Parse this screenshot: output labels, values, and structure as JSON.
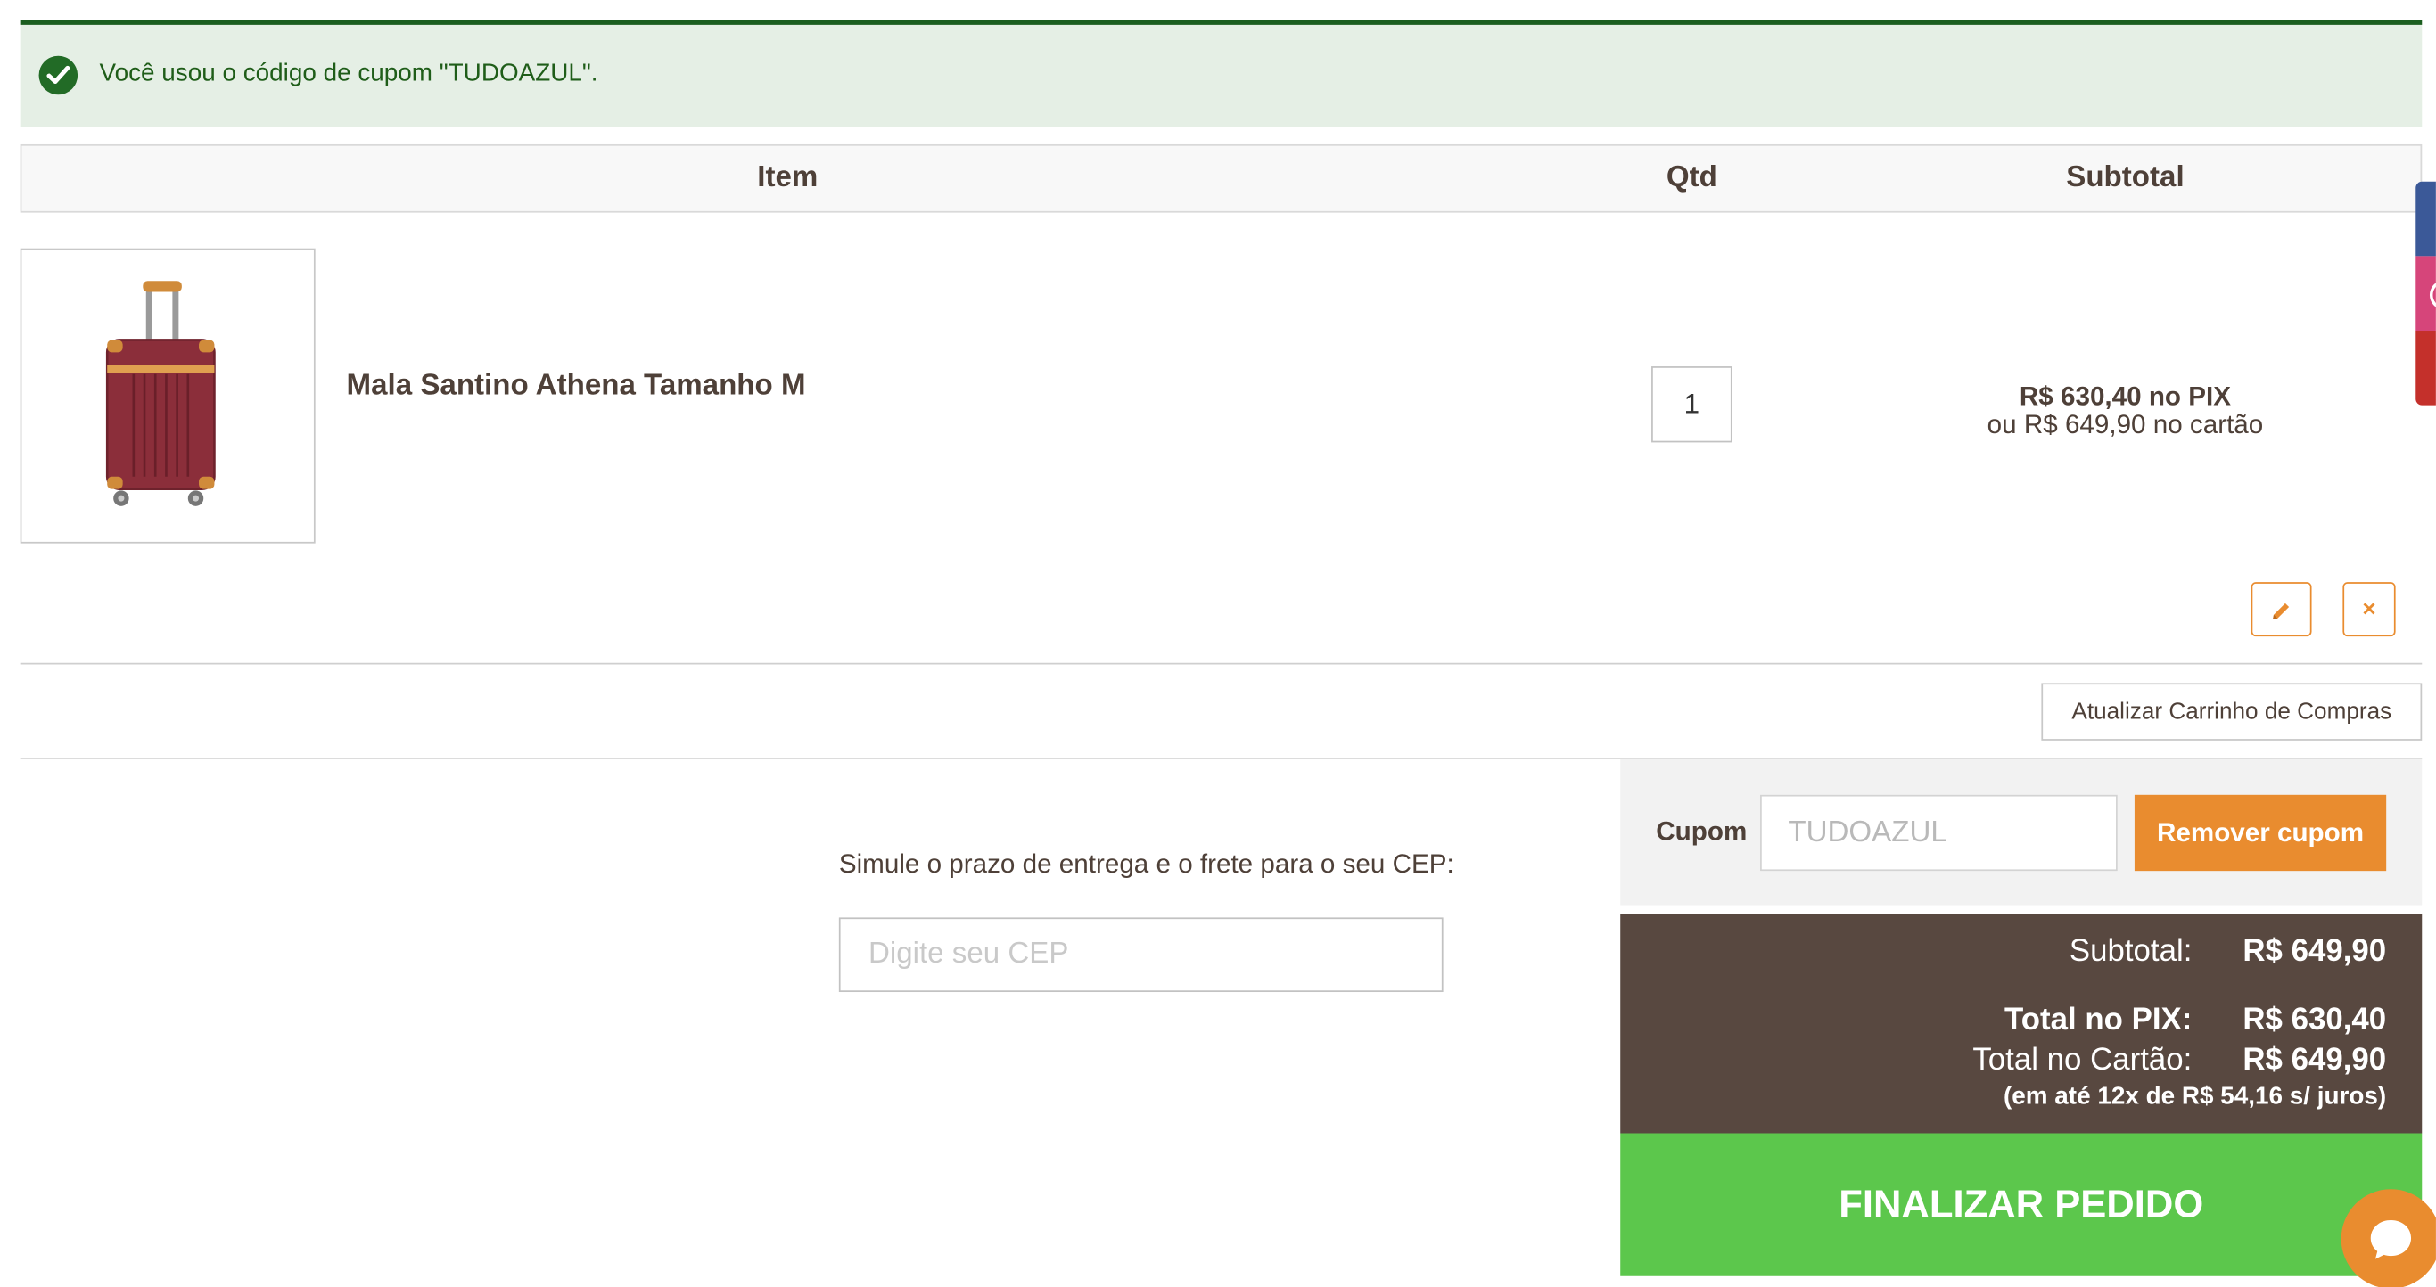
{
  "message": {
    "text": "Você usou o código de cupom \"TUDOAZUL\"."
  },
  "cart_table": {
    "headers": {
      "item": "Item",
      "qty": "Qtd",
      "subtotal": "Subtotal"
    },
    "items": [
      {
        "name": "Mala Santino Athena Tamanho M",
        "quantity": "1",
        "price_pix": "R$ 630,40 no PIX",
        "price_card": "ou R$ 649,90 no cartão"
      }
    ]
  },
  "actions": {
    "remove_symbol": "×",
    "update_cart_label": "Atualizar Carrinho de Compras"
  },
  "shipping": {
    "label": "Simule o prazo de entrega e o frete para o seu CEP:",
    "placeholder": "Digite seu CEP"
  },
  "coupon": {
    "label": "Cupom",
    "value": "TUDOAZUL",
    "remove_label": "Remover cupom"
  },
  "totals": {
    "subtotal_label": "Subtotal:",
    "subtotal_value": "R$ 649,90",
    "pix_label": "Total no PIX:",
    "pix_value": "R$ 630,40",
    "card_label": "Total no Cartão:",
    "card_value": "R$ 649,90",
    "installments": "(em até 12x de R$ 54,16 s/ juros)"
  },
  "checkout": {
    "label": "FINALIZAR PEDIDO"
  },
  "colors": {
    "accent_orange": "#e98c2f",
    "checkout_green": "#5cc74c",
    "totals_brown": "#584840",
    "success_green": "#226b26",
    "product_red": "#8b2e3a"
  },
  "icons": {
    "message": "check-circle-icon",
    "edit": "pencil-icon",
    "remove": "close-icon",
    "chat": "chat-bubble-icon"
  }
}
